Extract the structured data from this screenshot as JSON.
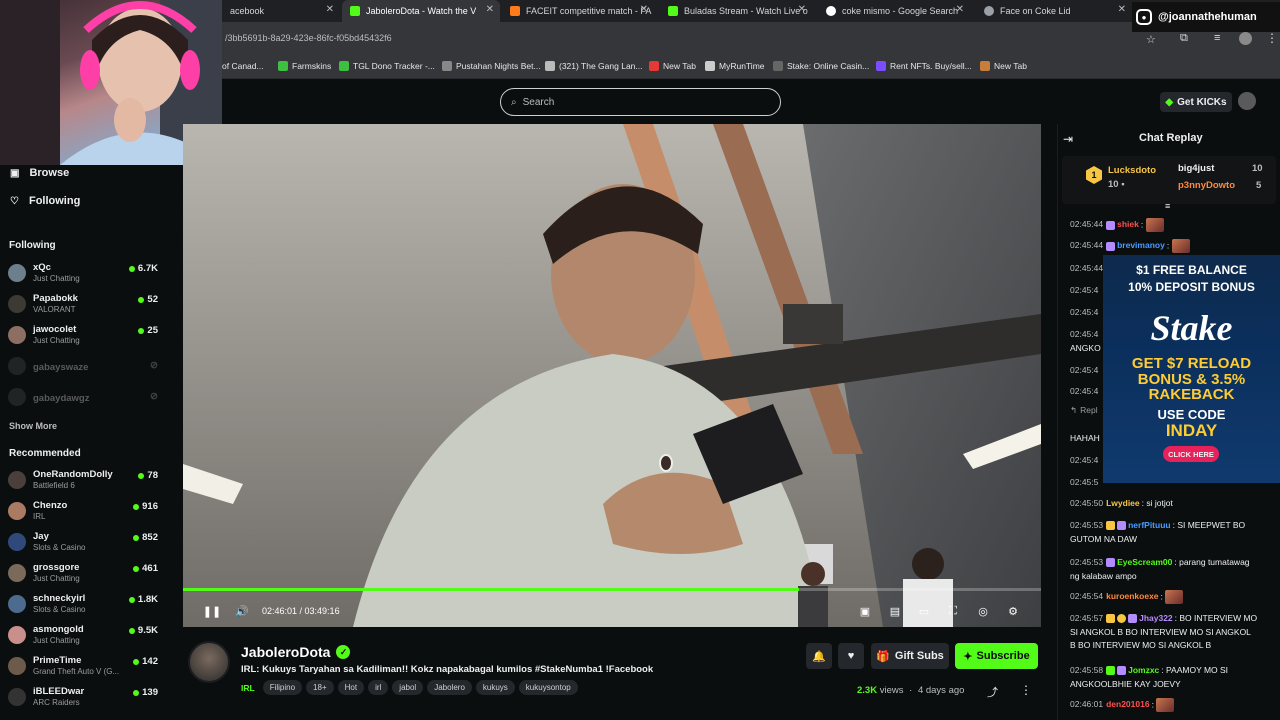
{
  "browser": {
    "tabs": [
      {
        "label": "acebook",
        "active": false
      },
      {
        "label": "JaboleroDota - Watch the V",
        "active": true
      },
      {
        "label": "FACEIT competitive match - FA",
        "active": false
      },
      {
        "label": "Buladas Stream - Watch Live o",
        "active": false
      },
      {
        "label": "coke mismo - Google Search",
        "active": false
      },
      {
        "label": "Face on Coke Lid",
        "active": false
      }
    ],
    "url": "/3bb5691b-8a29-423e-86fc-f05bd45432f6",
    "bookmarks": [
      "of Canad...",
      "Farmskins",
      "TGL Dono Tracker -...",
      "Pustahan Nights Bet...",
      "(321) The Gang Lan...",
      "New Tab",
      "MyRunTime",
      "Stake: Online Casin...",
      "Rent NFTs. Buy/sell...",
      "New Tab"
    ]
  },
  "social_overlay": {
    "handle": "@joannathehuman",
    "icon": "instagram-icon"
  },
  "header": {
    "search_placeholder": "Search",
    "get_kicks": "Get KICKs"
  },
  "sidebar": {
    "nav": [
      {
        "label": "Browse",
        "icon": "browse-icon"
      },
      {
        "label": "Following",
        "icon": "heart-icon"
      }
    ],
    "following_title": "Following",
    "following": [
      {
        "name": "xQc",
        "sub": "Just Chatting",
        "viewers": "6.7K",
        "live": true,
        "color": "#6d7f8a"
      },
      {
        "name": "Papabokk",
        "sub": "VALORANT",
        "viewers": "52",
        "live": true,
        "color": "#3d3a33"
      },
      {
        "name": "jawocolet",
        "sub": "Just Chatting",
        "viewers": "25",
        "live": true,
        "color": "#8d6e63"
      },
      {
        "name": "gabayswaze",
        "sub": "",
        "viewers": "",
        "live": false,
        "color": "#555"
      },
      {
        "name": "gabaydawgz",
        "sub": "",
        "viewers": "",
        "live": false,
        "color": "#555"
      }
    ],
    "show_more": "Show More",
    "recommended_title": "Recommended",
    "recommended": [
      {
        "name": "OneRandomDolly",
        "sub": "Battlefield 6",
        "viewers": "78",
        "color": "#4a3f3a"
      },
      {
        "name": "Chenzo",
        "sub": "IRL",
        "viewers": "916",
        "color": "#a97b63"
      },
      {
        "name": "Jay",
        "sub": "Slots & Casino",
        "viewers": "852",
        "color": "#2f4a7a"
      },
      {
        "name": "grossgore",
        "sub": "Just Chatting",
        "viewers": "461",
        "color": "#7b6a5a"
      },
      {
        "name": "schneckyirl",
        "sub": "Slots & Casino",
        "viewers": "1.8K",
        "color": "#4d6b8e"
      },
      {
        "name": "asmongold",
        "sub": "Just Chatting",
        "viewers": "9.5K",
        "color": "#c98f8a"
      },
      {
        "name": "PrimeTime",
        "sub": "Grand Theft Auto V (G...",
        "viewers": "142",
        "color": "#6e5a4a"
      },
      {
        "name": "iBLEEDwar",
        "sub": "ARC Raiders",
        "viewers": "139",
        "color": "#333"
      }
    ]
  },
  "player": {
    "time": "02:46:01 / 03:49:16",
    "progress": 0.718
  },
  "stream_info": {
    "channel": "JaboleroDota",
    "verified": true,
    "title": "IRL: Kukuys Taryahan sa Kadiliman!! Kokz napakabagal kumilos #StakeNumba1 !Facebook",
    "category": "IRL",
    "tags": [
      "Filipino",
      "18+",
      "Hot",
      "irl",
      "jabol",
      "Jabolero",
      "kukuys",
      "kukuysontop"
    ],
    "gift_subs": "Gift Subs",
    "subscribe": "Subscribe",
    "views": "2.3K",
    "views_label": "views",
    "ago": "4 days ago"
  },
  "chat": {
    "title": "Chat Replay",
    "leaderboard": [
      {
        "name": "Lucksdoto",
        "count": "10",
        "rank": "1"
      },
      {
        "name": "big4just",
        "count": "10"
      },
      {
        "name": "p3nnyDowto",
        "count": "5"
      }
    ],
    "messages": [
      {
        "ts": "02:45:44",
        "user": "shiek",
        "color": "#ff5050",
        "text": ":",
        "emote": true
      },
      {
        "ts": "02:45:44",
        "user": "brevimanoy",
        "color": "#4a9cff",
        "text": ":",
        "emote": true
      },
      {
        "ts": "02:45:44",
        "user": "",
        "color": "#fff",
        "text": ""
      },
      {
        "ts": "02:45:4",
        "user": "",
        "color": "#fff",
        "text": ""
      },
      {
        "ts": "02:45:4",
        "user": "",
        "color": "#fff",
        "text": ""
      },
      {
        "ts": "02:45:4",
        "user": "",
        "color": "#fff",
        "text": ""
      },
      {
        "ts": "ANGKO",
        "user": "",
        "color": "#fff",
        "text": ""
      },
      {
        "ts": "02:45:4",
        "user": "",
        "color": "#fff",
        "text": ""
      },
      {
        "ts": "02:45:4",
        "user": "",
        "color": "#fff",
        "text": ""
      },
      {
        "ts": "Repl",
        "user": "",
        "color": "#fff",
        "text": ""
      },
      {
        "ts": "HAHAH",
        "user": "",
        "color": "#fff",
        "text": ""
      },
      {
        "ts": "02:45:4",
        "user": "",
        "color": "#fff",
        "text": ""
      },
      {
        "ts": "02:45:5",
        "user": "",
        "color": "#fff",
        "text": ""
      },
      {
        "ts": "02:45:50",
        "user": "Lwydiee",
        "color": "#f7c643",
        "text": ": si jotjot"
      },
      {
        "ts": "02:45:53",
        "user": "nerfPituuu",
        "color": "#4a9cff",
        "text": ": SI MEEPWET BO GUTOM NA DAW"
      },
      {
        "ts": "02:45:53",
        "user": "EyeScream00",
        "color": "#53fc18",
        "text": ": parang tumatawag ng kalabaw ampo"
      },
      {
        "ts": "02:45:54",
        "user": "kuroenkoexe",
        "color": "#ff8a3d",
        "text": ":",
        "emote": true
      },
      {
        "ts": "02:45:57",
        "user": "Jhay322",
        "color": "#b58cff",
        "text": ": BO INTERVIEW MO SI ANGKOL B BO INTERVIEW MO SI ANGKOL B BO INTERVIEW MO SI ANGKOL B"
      },
      {
        "ts": "02:45:58",
        "user": "Jomzxc",
        "color": "#53fc18",
        "text": ": PAAMOY MO SI ANGKOOLBHIE KAY JOEVY"
      },
      {
        "ts": "02:46:01",
        "user": "den201016",
        "color": "#ff5050",
        "text": ":",
        "emote": true
      }
    ],
    "ad": {
      "line1": "$1 FREE BALANCE",
      "line2": "10% DEPOSIT BONUS",
      "brand": "Stake",
      "line3": "GET $7 RELOAD",
      "line4": "BONUS & 3.5%",
      "line5": "RAKEBACK",
      "line6": "USE CODE",
      "code": "INDAY",
      "cta": "CLICK HERE"
    }
  }
}
